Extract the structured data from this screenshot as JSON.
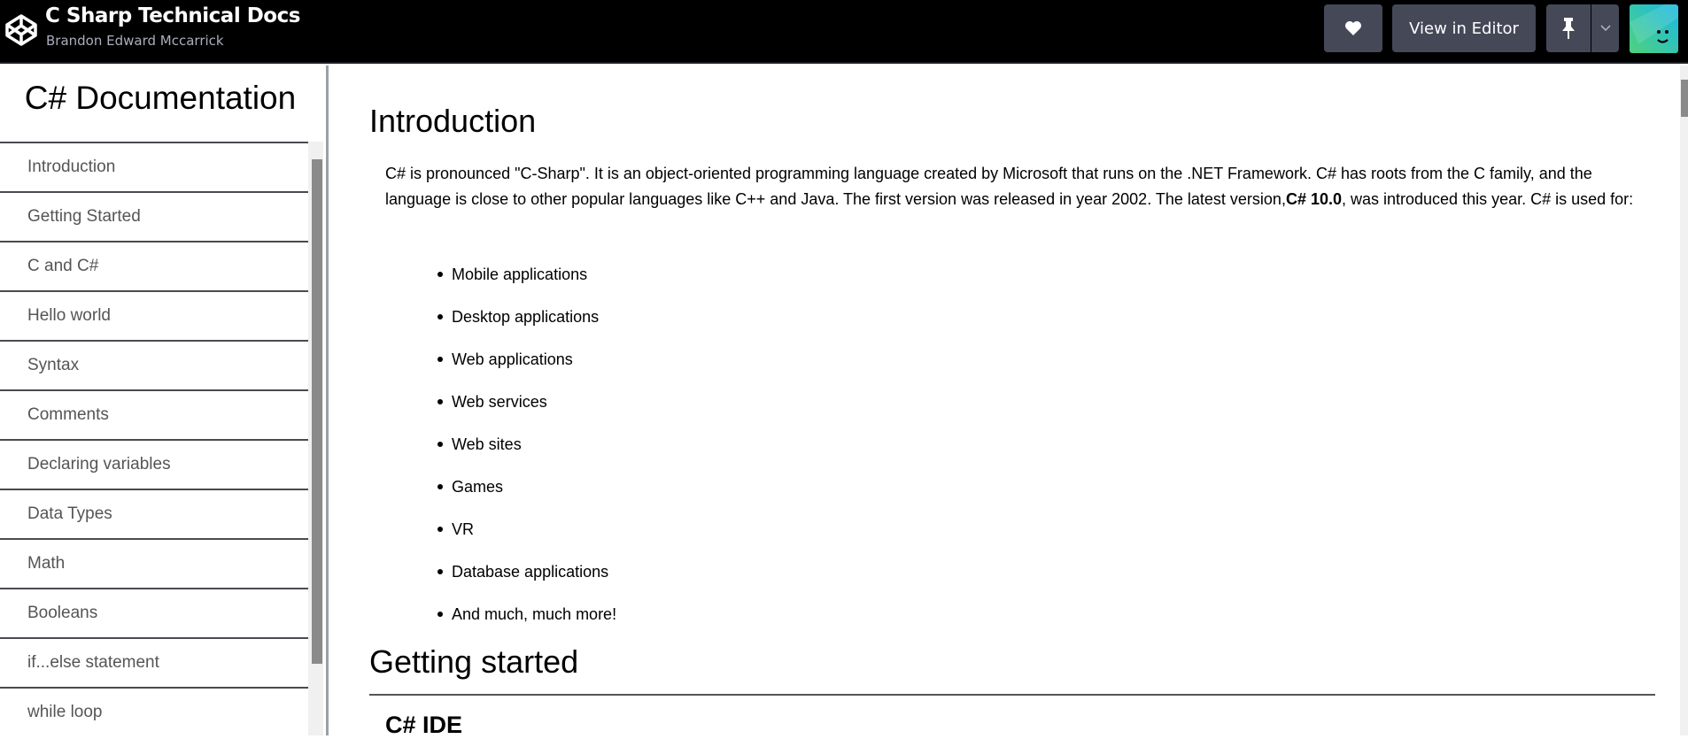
{
  "header": {
    "title": "C Sharp Technical Docs",
    "author": "Brandon Edward Mccarrick",
    "view_in_editor": "View in Editor",
    "icons": {
      "logo": "codepen-logo-icon",
      "like": "heart-icon",
      "pin": "pin-icon",
      "more": "chevron-down-icon"
    }
  },
  "sidebar": {
    "title": "C# Documentation",
    "items": [
      "Introduction",
      "Getting Started",
      "C and C#",
      "Hello world",
      "Syntax",
      "Comments",
      "Declaring variables",
      "Data Types",
      "Math",
      "Booleans",
      "if...else statement",
      "while loop"
    ]
  },
  "main": {
    "intro_title": "Introduction",
    "intro_text_1": "C# is pronounced \"C-Sharp\". It is an object-oriented programming language created by Microsoft that runs on the .NET Framework. C# has roots from the C family, and the language is close to other popular languages like C++ and Java. The first version was released in year 2002. The latest version,",
    "intro_bold": "C# 10.0",
    "intro_text_2": ", was introduced this year. C# is used for:",
    "uses": [
      "Mobile applications",
      "Desktop applications",
      "Web applications",
      "Web services",
      "Web sites",
      "Games",
      "VR",
      "Database applications",
      "And much, much more!"
    ],
    "getting_started_title": "Getting started",
    "ide_title": "C# IDE"
  }
}
